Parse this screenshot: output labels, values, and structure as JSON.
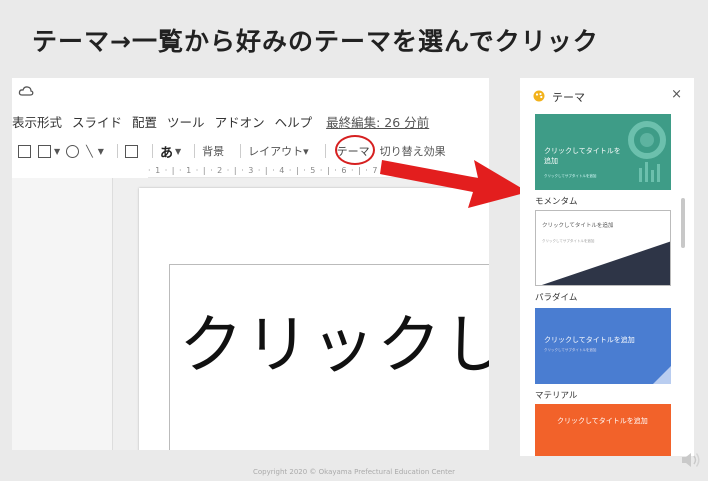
{
  "slide": {
    "title": "テーマ→一覧から好みのテーマを選んでクリック",
    "footer": "Copyright 2020 © Okayama Prefectural Education Center"
  },
  "editor": {
    "menu": [
      "表示形式",
      "スライド",
      "配置",
      "ツール",
      "アドオン",
      "ヘルプ"
    ],
    "last_edit": "最終編集: 26 分前",
    "toolbar": {
      "a_label": "あ",
      "background": "背景",
      "layout": "レイアウト▾",
      "theme": "テーマ",
      "transition": "切り替え効果"
    },
    "ruler": "· 1 · | · 1 · | · 2 · | · 3 · | · 4 · | · 5 · | · 6 · | · 7 ·",
    "canvas_text": "クリックし"
  },
  "theme_panel": {
    "title": "テーマ",
    "close": "×",
    "themes": [
      {
        "name": "モメンタム",
        "thumb_title": "クリックしてタイトルを追加",
        "thumb_sub": "クリックしてサブタイトルを追加",
        "color": "#3e9c87"
      },
      {
        "name": "パラダイム",
        "thumb_title": "クリックしてタイトルを追加",
        "thumb_sub": "クリックしてサブタイトルを追加",
        "color": "#2e3547"
      },
      {
        "name": "マテリアル",
        "thumb_title": "クリックしてタイトルを追加",
        "thumb_sub": "クリックしてサブタイトルを追加",
        "color": "#4a7dd1"
      },
      {
        "name": "",
        "thumb_title": "クリックしてタイトルを追加",
        "thumb_sub": "",
        "color": "#f2622a"
      }
    ]
  },
  "colors": {
    "highlight": "#d62020",
    "arrow": "#e31e1e"
  },
  "icons": [
    "cloud-icon",
    "palette-icon",
    "close-icon",
    "speaker-icon"
  ]
}
